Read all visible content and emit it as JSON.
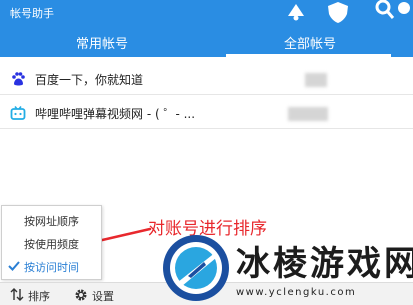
{
  "app": {
    "title": "帐号助手"
  },
  "tabs": [
    {
      "label": "常用帐号",
      "active": false
    },
    {
      "label": "全部帐号",
      "active": true
    }
  ],
  "accounts": [
    {
      "site": "百度一下，你就知道",
      "icon": "baidu-paw-icon",
      "account_masked": true
    },
    {
      "site": "哔哩哔哩弹幕视频网 - ( ゜- ...",
      "icon": "bilibili-tv-icon",
      "account_masked": true
    }
  ],
  "sort_menu": {
    "items": [
      {
        "label": "按网址顺序",
        "selected": false
      },
      {
        "label": "按使用频度",
        "selected": false
      },
      {
        "label": "按访问时间",
        "selected": true
      }
    ]
  },
  "annotation": {
    "text": "对账号进行排序",
    "color": "#e8282d"
  },
  "bottom_bar": {
    "sort_label": "排序",
    "settings_label": "设置"
  },
  "watermark": {
    "text": "冰棱游戏网",
    "url": "www.yclengku.com"
  },
  "colors": {
    "accent": "#2a8de3",
    "selected_text": "#2a7fd4"
  }
}
